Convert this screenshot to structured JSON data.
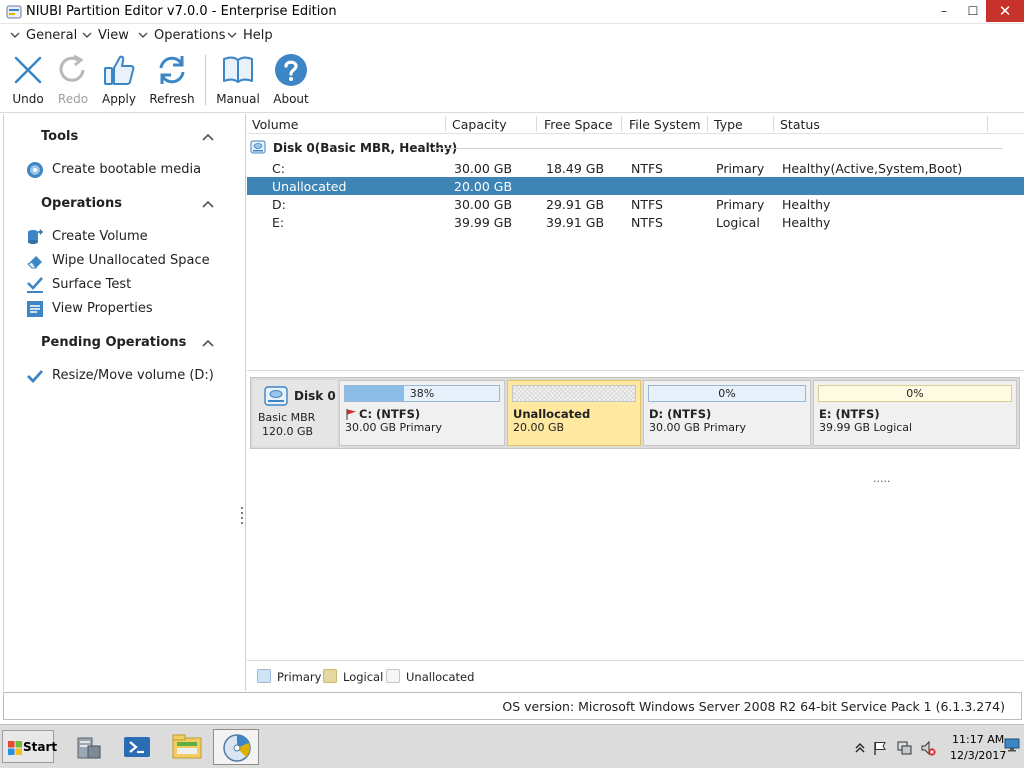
{
  "window": {
    "title": "NIUBI Partition Editor v7.0.0 - Enterprise Edition",
    "min_glyph": "–",
    "max_glyph": "☐",
    "close_glyph": "✕"
  },
  "menu": [
    "General",
    "View",
    "Operations",
    "Help"
  ],
  "toolbar": {
    "undo": "Undo",
    "redo": "Redo",
    "apply": "Apply",
    "refresh": "Refresh",
    "manual": "Manual",
    "about": "About",
    "redo_disabled": true
  },
  "left_panel": {
    "tools_title": "Tools",
    "tools_items": [
      "Create bootable media"
    ],
    "operations_title": "Operations",
    "operations_items": [
      "Create Volume",
      "Wipe Unallocated Space",
      "Surface Test",
      "View Properties"
    ],
    "pending_title": "Pending Operations",
    "pending_items": [
      "Resize/Move volume (D:)"
    ]
  },
  "volume_list": {
    "columns": [
      "Volume",
      "Capacity",
      "Free Space",
      "File System",
      "Type",
      "Status"
    ],
    "disk_label": "Disk 0(Basic MBR, Healthy)",
    "rows": [
      {
        "volume": "C:",
        "capacity": "30.00 GB",
        "free": "18.49 GB",
        "fs": "NTFS",
        "type": "Primary",
        "status": "Healthy(Active,System,Boot)",
        "selected": false
      },
      {
        "volume": "Unallocated",
        "capacity": "20.00 GB",
        "free": "",
        "fs": "",
        "type": "",
        "status": "",
        "selected": true
      },
      {
        "volume": "D:",
        "capacity": "30.00 GB",
        "free": "29.91 GB",
        "fs": "NTFS",
        "type": "Primary",
        "status": "Healthy",
        "selected": false
      },
      {
        "volume": "E:",
        "capacity": "39.99 GB",
        "free": "39.91 GB",
        "fs": "NTFS",
        "type": "Logical",
        "status": "Healthy",
        "selected": false
      }
    ],
    "grip": "....."
  },
  "disk_map": {
    "disk_name": "Disk 0",
    "disk_type": "Basic MBR",
    "disk_size": "120.0 GB",
    "partitions": [
      {
        "usage_label": "38%",
        "usage": 0.38,
        "name": "C: (NTFS)",
        "desc": "30.00 GB Primary",
        "kind": "primary",
        "selected": false,
        "boot_flag": true
      },
      {
        "usage_label": "",
        "usage": 0,
        "name": "Unallocated",
        "desc": "20.00 GB",
        "kind": "unallocated",
        "selected": true,
        "boot_flag": false
      },
      {
        "usage_label": "0%",
        "usage": 0,
        "name": "D: (NTFS)",
        "desc": "30.00 GB Primary",
        "kind": "primary",
        "selected": false,
        "boot_flag": false
      },
      {
        "usage_label": "0%",
        "usage": 0,
        "name": "E: (NTFS)",
        "desc": "39.99 GB Logical",
        "kind": "logical",
        "selected": false,
        "boot_flag": false
      }
    ]
  },
  "legend": {
    "primary": "Primary",
    "logical": "Logical",
    "unallocated": "Unallocated"
  },
  "status_bar": {
    "os_version": "OS version: Microsoft Windows Server 2008 R2  64-bit Service Pack 1 (6.1.3.274)"
  },
  "taskbar": {
    "start_label": "Start",
    "clock_time": "11:17 AM",
    "clock_date": "12/3/2017"
  },
  "colors": {
    "selection": "#3e84b5",
    "close_button": "#c7332c",
    "accent_blue": "#3d86c6",
    "unallocated_selected": "#ffe8a0",
    "primary_fill": "#8bbde8"
  }
}
